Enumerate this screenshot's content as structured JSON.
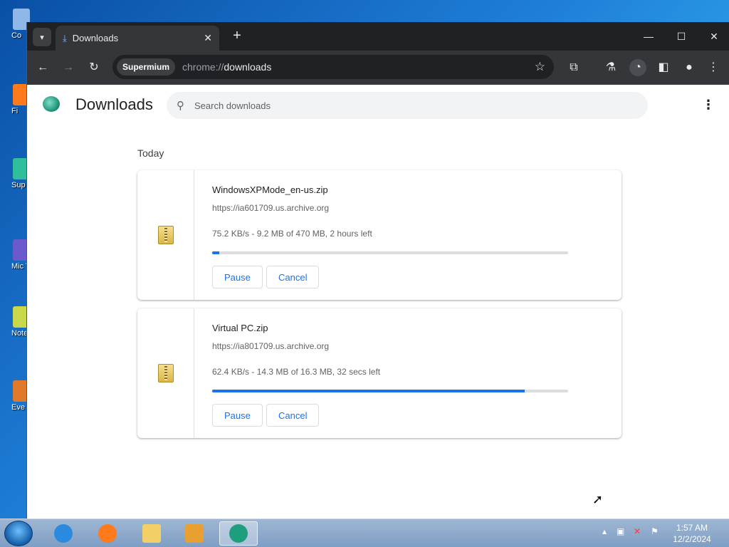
{
  "desktop": {
    "icons": [
      {
        "label": "Co",
        "color": "#8fb8e8"
      },
      {
        "label": "Fi",
        "color": "#ff7a1a"
      },
      {
        "label": "Sup",
        "color": "#2fbf9a"
      },
      {
        "label": "Mic Visua",
        "color": "#6a5acd"
      },
      {
        "label": "Note",
        "color": "#c8d84a"
      },
      {
        "label": "Eve",
        "color": "#e07a2a"
      }
    ]
  },
  "browser": {
    "tab_title": "Downloads",
    "chip_label": "Supermium",
    "url_scheme": "chrome://",
    "url_path": "downloads"
  },
  "page": {
    "title": "Downloads",
    "search_placeholder": "Search downloads",
    "section_label": "Today",
    "downloads": [
      {
        "filename": "WindowsXPMode_en-us.zip",
        "source": "https://ia601709.us.archive.org",
        "status": "75.2 KB/s - 9.2 MB of 470 MB, 2 hours left",
        "progress": 0.0196,
        "pause_label": "Pause",
        "cancel_label": "Cancel"
      },
      {
        "filename": "Virtual PC.zip",
        "source": "https://ia801709.us.archive.org",
        "status": "62.4 KB/s - 14.3 MB of 16.3 MB, 32 secs left",
        "progress": 0.877,
        "pause_label": "Pause",
        "cancel_label": "Cancel"
      }
    ]
  },
  "taskbar": {
    "time": "1:57 AM",
    "date": "12/2/2024"
  },
  "colors": {
    "accent": "#1a73e8",
    "toolbar": "#35363a",
    "tabstrip": "#202124"
  }
}
